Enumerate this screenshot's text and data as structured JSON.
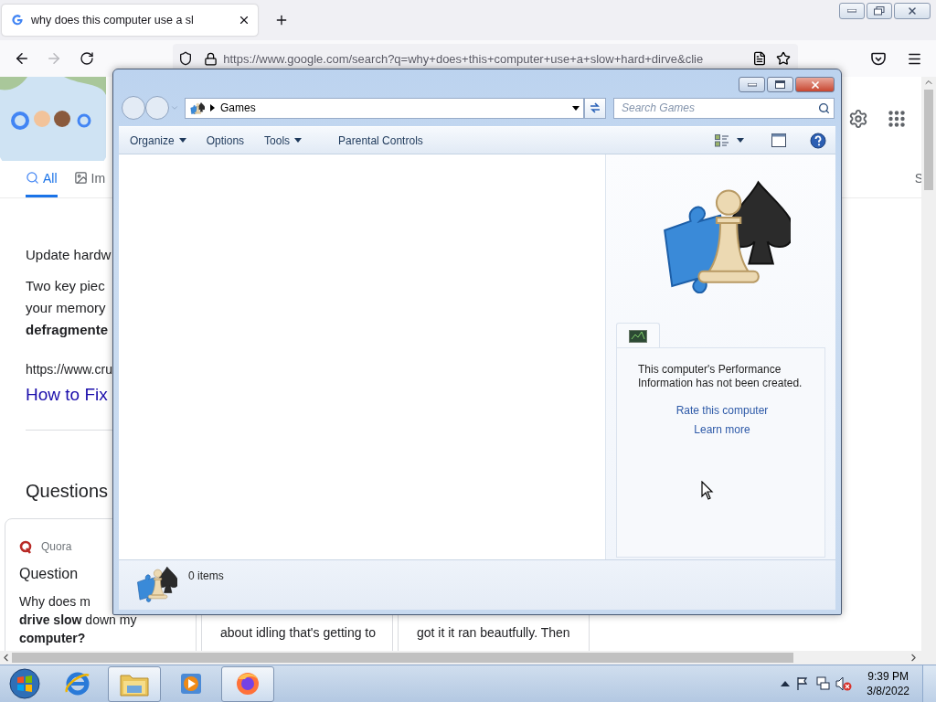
{
  "browser": {
    "tab": {
      "title": "why does this computer use a sl",
      "selected": true
    },
    "forward": {
      "disabled": true
    },
    "url": "https://www.google.com/search?q=why+does+this+computer+use+a+slow+hard+dirve&clie"
  },
  "page": {
    "search_tabs": [
      {
        "label": "All",
        "selected": true,
        "kind": "all"
      },
      {
        "label": "Im",
        "selected": false,
        "kind": "images"
      },
      {
        "label": "S",
        "selected": false,
        "kind": "plain"
      }
    ],
    "result": {
      "title": "Update hardw",
      "lines": [
        {
          "text": "Two key piec",
          "bold": false
        },
        {
          "text": "your memory",
          "bold": false
        },
        {
          "text": "defragmente",
          "bold": true
        }
      ],
      "url": "https://www.cru",
      "link": "How to Fix"
    },
    "questions": {
      "heading": "Questions",
      "cards": [
        {
          "source": "Quora",
          "title": "Question",
          "lines": [
            {
              "text": "Why does m",
              "bold": false
            },
            {
              "text": "**drive slow** down my",
              "bold": false
            },
            {
              "text": "computer?",
              "bold": true
            }
          ]
        },
        {
          "lines": [
            {
              "text": "about idling that's getting to",
              "bold": false
            }
          ]
        },
        {
          "lines": [
            {
              "text": "got it it ran beautfully. Then",
              "bold": false
            }
          ]
        }
      ]
    }
  },
  "explorer": {
    "address": "Games",
    "search": {
      "placeholder": "Search Games"
    },
    "toolbar": [
      {
        "label": "Organize",
        "dropdown": true
      },
      {
        "label": "Options",
        "dropdown": false
      },
      {
        "label": "Tools",
        "dropdown": true
      },
      {
        "label": "Parental Controls",
        "dropdown": false
      }
    ],
    "preview": {
      "message": "This computer's Performance Information has not been created.",
      "links": [
        "Rate this computer",
        "Learn more"
      ]
    },
    "status": "0 items"
  },
  "taskbar": {
    "items": [
      {
        "kind": "ie",
        "active": false
      },
      {
        "kind": "explorer",
        "active": true
      },
      {
        "kind": "media",
        "active": false
      },
      {
        "kind": "firefox",
        "active": true
      }
    ],
    "time": "9:39 PM",
    "date": "3/8/2022"
  }
}
